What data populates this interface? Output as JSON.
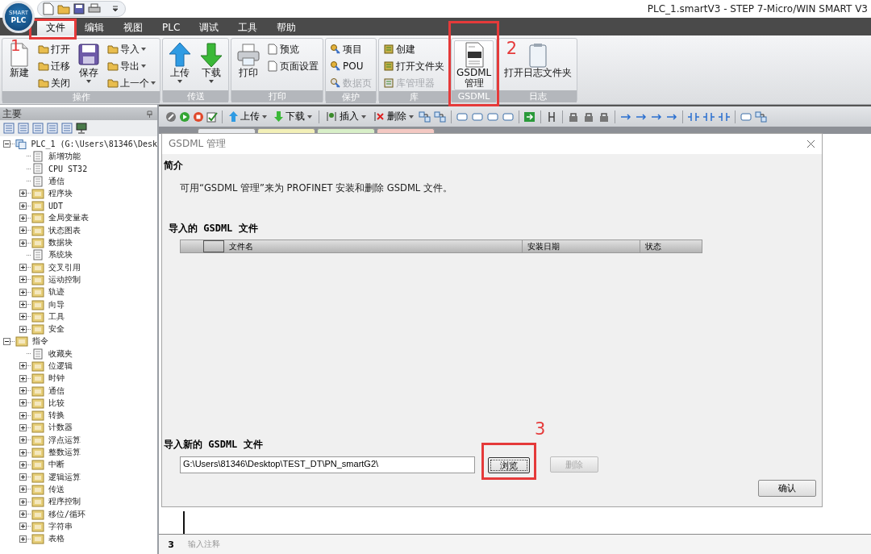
{
  "title_bar": {
    "logo_top": "SMART",
    "logo_main": "PLC",
    "title": "PLC_1.smartV3 - STEP 7-Micro/WIN SMART V3"
  },
  "menu_tabs": [
    {
      "label": "文件",
      "selected": true,
      "callout": "1"
    },
    {
      "label": "编辑",
      "selected": false
    },
    {
      "label": "视图",
      "selected": false
    },
    {
      "label": "PLC",
      "selected": false
    },
    {
      "label": "调试",
      "selected": false
    },
    {
      "label": "工具",
      "selected": false
    },
    {
      "label": "帮助",
      "selected": false
    }
  ],
  "ribbon_groups": [
    {
      "label": "操作",
      "columns": [
        {
          "kind": "big",
          "label": "新建",
          "dropdown": false,
          "pressed": false
        },
        {
          "kind": "small",
          "items": [
            {
              "label": "打开",
              "dropdown": false,
              "disabled": false
            },
            {
              "label": "迁移",
              "dropdown": false,
              "disabled": false
            },
            {
              "label": "关闭",
              "dropdown": false,
              "disabled": false
            }
          ]
        },
        {
          "kind": "big",
          "label": "保存",
          "dropdown": true,
          "pressed": false
        },
        {
          "kind": "small",
          "items": [
            {
              "label": "导入",
              "dropdown": true,
              "disabled": false
            },
            {
              "label": "导出",
              "dropdown": true,
              "disabled": false
            },
            {
              "label": "上一个",
              "dropdown": true,
              "disabled": false
            }
          ]
        }
      ]
    },
    {
      "label": "传送",
      "columns": [
        {
          "kind": "big",
          "label": "上传",
          "dropdown": true,
          "pressed": false
        },
        {
          "kind": "big",
          "label": "下载",
          "dropdown": true,
          "pressed": false
        }
      ]
    },
    {
      "label": "打印",
      "columns": [
        {
          "kind": "big",
          "label": "打印",
          "dropdown": false,
          "pressed": false
        },
        {
          "kind": "small",
          "items": [
            {
              "label": "预览",
              "dropdown": false,
              "disabled": false
            },
            {
              "label": "页面设置",
              "dropdown": false,
              "disabled": false
            }
          ]
        }
      ]
    },
    {
      "label": "保护",
      "columns": [
        {
          "kind": "small",
          "items": [
            {
              "label": "项目",
              "dropdown": false,
              "disabled": false
            },
            {
              "label": "POU",
              "dropdown": false,
              "disabled": false
            },
            {
              "label": "数据页",
              "dropdown": false,
              "disabled": true
            }
          ]
        }
      ]
    },
    {
      "label": "库",
      "columns": [
        {
          "kind": "small",
          "items": [
            {
              "label": "创建",
              "dropdown": false,
              "disabled": false
            },
            {
              "label": "打开文件夹",
              "dropdown": false,
              "disabled": false
            },
            {
              "label": "库管理器",
              "dropdown": false,
              "disabled": true
            }
          ]
        }
      ]
    },
    {
      "label": "GSDML",
      "callout": "2",
      "columns": [
        {
          "kind": "big",
          "label": "GSDML 管理",
          "dropdown": false,
          "pressed": true
        }
      ]
    },
    {
      "label": "日志",
      "columns": [
        {
          "kind": "big",
          "label": "打开日志文件夹",
          "dropdown": false,
          "pressed": false
        }
      ]
    }
  ],
  "sidebar": {
    "title": "主要",
    "tree": [
      {
        "label": "PLC_1 (G:\\Users\\81346\\Desk",
        "kind": "project",
        "expanded": true,
        "children": [
          {
            "label": "新增功能",
            "kind": "leaf"
          },
          {
            "label": "CPU ST32",
            "kind": "leaf"
          },
          {
            "label": "通信",
            "kind": "leaf"
          },
          {
            "label": "程序块",
            "kind": "group",
            "expanded": false
          },
          {
            "label": "UDT",
            "kind": "group",
            "expanded": false
          },
          {
            "label": "全局变量表",
            "kind": "group",
            "expanded": false
          },
          {
            "label": "状态图表",
            "kind": "group",
            "expanded": false
          },
          {
            "label": "数据块",
            "kind": "group",
            "expanded": false
          },
          {
            "label": "系统块",
            "kind": "leaf"
          },
          {
            "label": "交叉引用",
            "kind": "group",
            "expanded": false
          },
          {
            "label": "运动控制",
            "kind": "group",
            "expanded": false
          },
          {
            "label": "轨迹",
            "kind": "group",
            "expanded": false
          },
          {
            "label": "向导",
            "kind": "group",
            "expanded": false
          },
          {
            "label": "工具",
            "kind": "group",
            "expanded": false
          },
          {
            "label": "安全",
            "kind": "group",
            "expanded": false
          }
        ]
      },
      {
        "label": "指令",
        "kind": "group",
        "expanded": true,
        "children": [
          {
            "label": "收藏夹",
            "kind": "leaf"
          },
          {
            "label": "位逻辑",
            "kind": "group",
            "expanded": false
          },
          {
            "label": "时钟",
            "kind": "group",
            "expanded": false
          },
          {
            "label": "通信",
            "kind": "group",
            "expanded": false
          },
          {
            "label": "比较",
            "kind": "group",
            "expanded": false
          },
          {
            "label": "转换",
            "kind": "group",
            "expanded": false
          },
          {
            "label": "计数器",
            "kind": "group",
            "expanded": false
          },
          {
            "label": "浮点运算",
            "kind": "group",
            "expanded": false
          },
          {
            "label": "整数运算",
            "kind": "group",
            "expanded": false
          },
          {
            "label": "中断",
            "kind": "group",
            "expanded": false
          },
          {
            "label": "逻辑运算",
            "kind": "group",
            "expanded": false
          },
          {
            "label": "传送",
            "kind": "group",
            "expanded": false
          },
          {
            "label": "程序控制",
            "kind": "group",
            "expanded": false
          },
          {
            "label": "移位/循环",
            "kind": "group",
            "expanded": false
          },
          {
            "label": "字符串",
            "kind": "group",
            "expanded": false
          },
          {
            "label": "表格",
            "kind": "group",
            "expanded": false
          }
        ]
      }
    ]
  },
  "toolbar": {
    "buttons": [
      {
        "label": "上传",
        "dropdown": true
      },
      {
        "label": "下载",
        "dropdown": true
      },
      {
        "label": "插入",
        "dropdown": true
      },
      {
        "label": "删除",
        "dropdown": true
      }
    ]
  },
  "dialog": {
    "title": "GSDML 管理",
    "intro_heading": "简介",
    "intro_text": "可用“GSDML 管理”来为 PROFINET 安装和删除 GSDML 文件。",
    "imported_heading": "导入的 GSDML 文件",
    "table": {
      "columns": [
        "文件名",
        "安装日期",
        "状态"
      ]
    },
    "import_heading": "导入新的 GSDML 文件",
    "path_field": {
      "value": "G:\\Users\\81346\\Desktop\\TEST_DT\\PN_smartG2\\"
    },
    "browse_button": {
      "label": "浏览",
      "disabled": false,
      "callout": "3"
    },
    "delete_button": {
      "label": "删除",
      "disabled": true
    },
    "confirm_button": {
      "label": "确认",
      "disabled": false
    }
  },
  "editor": {
    "line_number": "3",
    "comment_placeholder": "输入注释"
  }
}
